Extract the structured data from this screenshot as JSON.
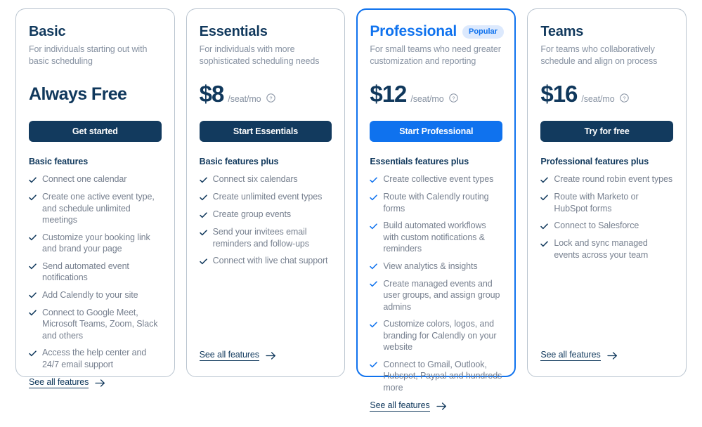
{
  "colors": {
    "navy": "#10385c",
    "accent_blue": "#0f72ee",
    "badge_bg": "#dce9fd",
    "feature_text": "#77808f",
    "card_border": "#b9c4cf"
  },
  "common": {
    "see_all_label": "See all features",
    "arrow_icon": "arrow-right-icon",
    "info_icon": "question-circle-icon",
    "check_icon": "check-icon"
  },
  "plans": [
    {
      "id": "basic",
      "name": "Basic",
      "badge": null,
      "description": "For individuals starting out with basic scheduling",
      "price": "Always Free",
      "price_is_wordmark": true,
      "price_unit": null,
      "has_info_icon": false,
      "cta_label": "Get started",
      "cta_style": "navy",
      "features_title": "Basic features",
      "features": [
        "Connect one calendar",
        "Create one active event type, and schedule unlimited meetings",
        "Customize your booking link and brand your page",
        "Send automated event notifications",
        "Add Calendly to your site",
        "Connect to Google Meet, Microsoft Teams, Zoom, Slack and others",
        "Access the help center and 24/7 email support"
      ]
    },
    {
      "id": "essentials",
      "name": "Essentials",
      "badge": null,
      "description": "For individuals with more sophisticated scheduling needs",
      "price": "$8",
      "price_is_wordmark": false,
      "price_unit": "/seat/mo",
      "has_info_icon": true,
      "cta_label": "Start Essentials",
      "cta_style": "navy",
      "features_title": "Basic features plus",
      "features": [
        "Connect six calendars",
        "Create unlimited event types",
        "Create group events",
        "Send your invitees email reminders and follow-ups",
        "Connect with live chat support"
      ]
    },
    {
      "id": "professional",
      "name": "Professional",
      "badge": "Popular",
      "description": "For small teams who need greater customization and reporting",
      "price": "$12",
      "price_is_wordmark": false,
      "price_unit": "/seat/mo",
      "has_info_icon": true,
      "cta_label": "Start Professional",
      "cta_style": "accent",
      "features_title": "Essentials features plus",
      "features": [
        "Create collective event types",
        "Route with Calendly routing forms",
        "Build automated workflows with custom notifications & reminders",
        "View analytics & insights",
        "Create managed events and user groups, and assign group admins",
        "Customize colors, logos, and branding for Calendly on your website",
        "Connect to Gmail, Outlook, Hubspot, Paypal and hundreds more"
      ]
    },
    {
      "id": "teams",
      "name": "Teams",
      "badge": null,
      "description": "For teams who collaboratively schedule and align on process",
      "price": "$16",
      "price_is_wordmark": false,
      "price_unit": "/seat/mo",
      "has_info_icon": true,
      "cta_label": "Try for free",
      "cta_style": "navy",
      "features_title": "Professional features plus",
      "features": [
        "Create round robin event types",
        "Route with Marketo or HubSpot forms",
        "Connect to Salesforce",
        "Lock and sync managed events across your team"
      ]
    }
  ]
}
